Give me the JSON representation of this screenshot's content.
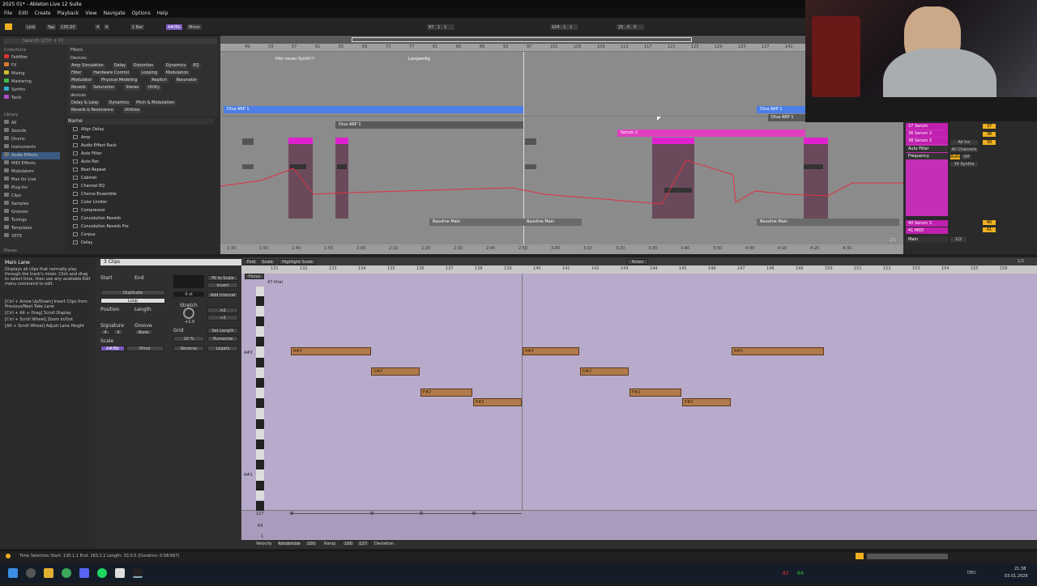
{
  "window": {
    "title": "2025 01* - Ableton Live 12 Suite"
  },
  "menu": [
    "File",
    "Edit",
    "Create",
    "Playback",
    "View",
    "Navigate",
    "Options",
    "Help"
  ],
  "transport": {
    "link": "Link",
    "tap": "Tap",
    "tempo": "135.00",
    "sig_num": "4",
    "sig_den": "4",
    "quant": "1 Bar",
    "key": "A#/Bb",
    "scale": "Minor",
    "position": "97 . 1 . 1",
    "loop_start": "104 . 1 . 1",
    "loop_len": "25 . 0 . 0"
  },
  "browser": {
    "search": "Search (Ctrl + F)",
    "collections_label": "Collections",
    "collections": [
      {
        "name": "Fabfilter",
        "color": "#e03030"
      },
      {
        "name": "FX",
        "color": "#e07a30"
      },
      {
        "name": "Mixing",
        "color": "#d0c030"
      },
      {
        "name": "Mastering",
        "color": "#40c040"
      },
      {
        "name": "Synths",
        "color": "#30b0d0"
      },
      {
        "name": "Tools",
        "color": "#b050d0"
      }
    ],
    "library_label": "Library",
    "library": [
      "All",
      "Sounds",
      "Drums",
      "Instruments",
      "Audio Effects",
      "MIDI Effects",
      "Modulators",
      "Max for Live",
      "Plug-Ins",
      "Clips",
      "Samples",
      "Grooves",
      "Tunings",
      "Templates",
      "VST3"
    ],
    "places_label": "Places",
    "filters_label": "Filters",
    "devices_label": "Devices",
    "device_tags": [
      "Amp Simulation",
      "Delay",
      "Distortion",
      "Dynamics",
      "EQ",
      "Filter",
      "Hardware Control",
      "Looping",
      "Modulation",
      "Modulator",
      "Physical Modeling",
      "Repitch",
      "Resonator",
      "Reverb",
      "Saturation",
      "Stereo",
      "Utility"
    ],
    "devices2_label": "devices",
    "devices2_tags": [
      "Delay & Loop",
      "Dynamics",
      "Pitch & Modulation",
      "Reverb & Resonance",
      "Utilities"
    ],
    "name_header": "Name",
    "items": [
      "Align Delay",
      "Amp",
      "Audio Effect Rack",
      "Auto Filter",
      "Auto Pan",
      "Beat Repeat",
      "Cabinet",
      "Channel EQ",
      "Chorus-Ensemble",
      "Color Limiter",
      "Compressor",
      "Convolution Reverb",
      "Convolution Reverb Pro",
      "Corpus",
      "Delay"
    ]
  },
  "arrangement": {
    "ruler": [
      "49",
      "53",
      "57",
      "61",
      "65",
      "69",
      "73",
      "77",
      "81",
      "85",
      "89",
      "93",
      "97",
      "101",
      "105",
      "109",
      "113",
      "117",
      "121",
      "125",
      "129",
      "133",
      "137",
      "141"
    ],
    "locators": [
      "Hier neuer Synth!!!",
      "Langweilig"
    ],
    "clips": {
      "diva_arp_a": "Diva ARP 1",
      "diva_arp_b": "Diva ARP 1",
      "diva_arp_c": "Diva ARP 1",
      "diva_arp_d": "Diva ARP 1",
      "serum": "Serum 2",
      "bass1": "Bassline Main",
      "bass2": "Bassline Main",
      "bass3": "Bassline Main"
    },
    "times": [
      "1:30",
      "1:50",
      "1:40",
      "1:50",
      "2:00",
      "2:10",
      "2:20",
      "2:30",
      "2:40",
      "2:50",
      "3:00",
      "3:10",
      "3:20",
      "3:30",
      "3:40",
      "3:50",
      "4:00",
      "4:10",
      "4:20",
      "4:30"
    ],
    "page": "2/1"
  },
  "mixer": {
    "tracks": [
      {
        "name": "27 Serum",
        "color": "#e040e0",
        "vol": "37"
      },
      {
        "name": "36 Serum 2",
        "color": "#e040e0",
        "vol": "38"
      },
      {
        "name": "38 Serum 3",
        "color": "#e040e0",
        "vol": "39"
      }
    ],
    "device": "Auto Filter",
    "param": "Frequency",
    "input": "All Ins",
    "channel": "All Channels",
    "auto": "Auto",
    "off": "Off",
    "output": "34 Synths",
    "bottom": [
      {
        "name": "40 Serum 3",
        "vol": "40"
      },
      {
        "name": "41 MIDI",
        "vol": "41"
      }
    ],
    "main": "Main",
    "main_val": "1/2"
  },
  "info": {
    "title": "Main Lane",
    "text": "Displays all clips that normally play through the track's mixer. Click and drag to select time, then use any available Edit menu command to edit.",
    "hints": [
      "[Ctrl + Arrow Up/Down] Insert Clips from Previous/Next Take Lane",
      "[Ctrl + Alt + Drag] Scroll Display",
      "[Ctrl + Scroll Wheel] Zoom In/Out",
      "[Alt + Scroll Wheel] Adjust Lane Height"
    ]
  },
  "clipview": {
    "tab": "3 Clips",
    "start": "Start",
    "end": "End",
    "duplicate": "Duplicate",
    "loop": "Loop",
    "position": "Position",
    "length": "Length",
    "signature": "Signature",
    "sig_num": "4",
    "sig_den": "4",
    "groove": "Groove",
    "groove_val": "None",
    "scale": "Scale",
    "scale_key": "A#/Bb",
    "scale_mode": "Minor",
    "fit": "Fit to Scale",
    "invert": "Invert",
    "add_interval": "Add Interval",
    "stretch": "Stretch",
    "stretch_val": "+1.0",
    "x2": "×2",
    "div2": "÷2",
    "grid": "Grid",
    "set_length": "Set Length",
    "humanize": "Humanize",
    "pct": "10 %",
    "reverse": "Reverse",
    "legato": "Legato",
    "zero": "0 st"
  },
  "midi": {
    "tabs": {
      "fold": "Fold",
      "scale": "Scale",
      "highlight": "Highlight Scale",
      "notes": "Notes",
      "focus": "Focus"
    },
    "clipname": "47-Vital",
    "bars": [
      "131",
      "132",
      "133",
      "134",
      "135",
      "136",
      "137",
      "138",
      "139",
      "140",
      "141",
      "142",
      "143",
      "144",
      "145",
      "146",
      "147",
      "148",
      "149",
      "150",
      "151",
      "152",
      "153",
      "154",
      "155",
      "156"
    ],
    "key_labels": {
      "a2": "A#2",
      "a1": "A#1"
    },
    "notes": [
      {
        "n": "A#2"
      },
      {
        "n": "G#2"
      },
      {
        "n": "F#2"
      },
      {
        "n": "E#2"
      },
      {
        "n": "A#2"
      },
      {
        "n": "G#2"
      },
      {
        "n": "F#2"
      },
      {
        "n": "E#2"
      },
      {
        "n": "A#2"
      }
    ],
    "velocity": {
      "v127": "127",
      "v64": "64",
      "v1": "1",
      "label": "Velocity",
      "randomize": "Randomize",
      "ramp": "Ramp",
      "val100": "100",
      "val127": "127",
      "deviation": "Deviation"
    },
    "page": "1/2"
  },
  "status": {
    "text": "Time Selection   Start: 130.1.1   End: 163.1.1   Length: 33.0.0 (Duration: 0:58:667)"
  },
  "taskbar": {
    "lang": "DEU",
    "time": "21:38",
    "date": "03.01.2026",
    "n1": "82",
    "n2": "64"
  }
}
